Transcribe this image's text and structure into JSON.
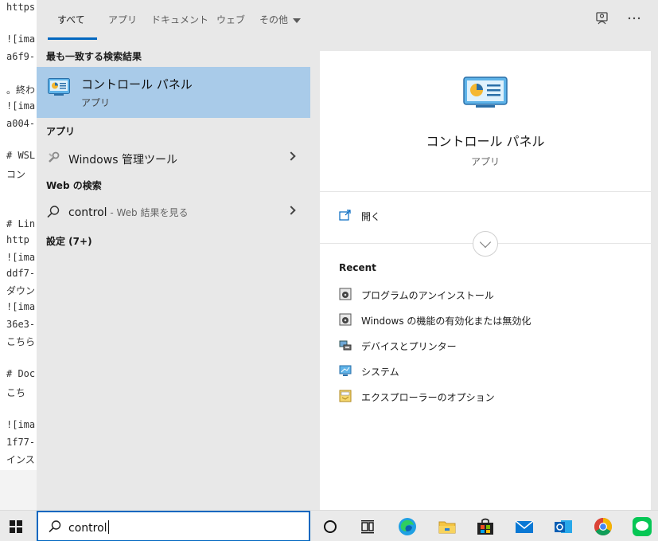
{
  "background_editor": {
    "lines": [
      "https",
      "![ima",
      "a6f9-",
      "。終わ",
      "![ima",
      "a004-",
      "# WSL",
      "  コン",
      "# Lin",
      " http",
      "![ima",
      "ddf7-",
      "ダウン",
      "![ima",
      "36e3-",
      "こちら",
      "# Doc",
      "  こち",
      "![ima",
      "1f77-",
      "インス"
    ]
  },
  "tabs": {
    "all": "すべて",
    "apps": "アプリ",
    "documents": "ドキュメント",
    "web": "ウェブ",
    "more": "その他"
  },
  "toolbar": {
    "feedback_icon": "feedback-icon",
    "more_icon": "ellipsis-icon"
  },
  "left": {
    "best_match_header": "最も一致する検索結果",
    "best_match": {
      "title": "コントロール パネル",
      "subtitle": "アプリ"
    },
    "apps_header": "アプリ",
    "apps": [
      {
        "label": "Windows 管理ツール"
      }
    ],
    "web_header": "Web の検索",
    "web": {
      "query": "control",
      "hint": " - Web 結果を見る"
    },
    "settings_header": "設定 (7+)"
  },
  "preview": {
    "title": "コントロール パネル",
    "subtitle": "アプリ",
    "open_label": "開く",
    "recent_header": "Recent",
    "recent": [
      {
        "label": "プログラムのアンインストール",
        "icon": "uninstall-icon"
      },
      {
        "label": "Windows の機能の有効化または無効化",
        "icon": "windows-features-icon"
      },
      {
        "label": "デバイスとプリンター",
        "icon": "devices-printers-icon"
      },
      {
        "label": "システム",
        "icon": "system-icon"
      },
      {
        "label": "エクスプローラーのオプション",
        "icon": "explorer-options-icon"
      }
    ]
  },
  "taskbar": {
    "search_value": "control",
    "apps": [
      "cortana",
      "task-view",
      "edge",
      "file-explorer",
      "store",
      "mail",
      "outlook",
      "chrome",
      "line"
    ]
  },
  "colors": {
    "accent": "#0067c0",
    "selection": "#a9cbe9",
    "panel": "#e8e8e8"
  }
}
